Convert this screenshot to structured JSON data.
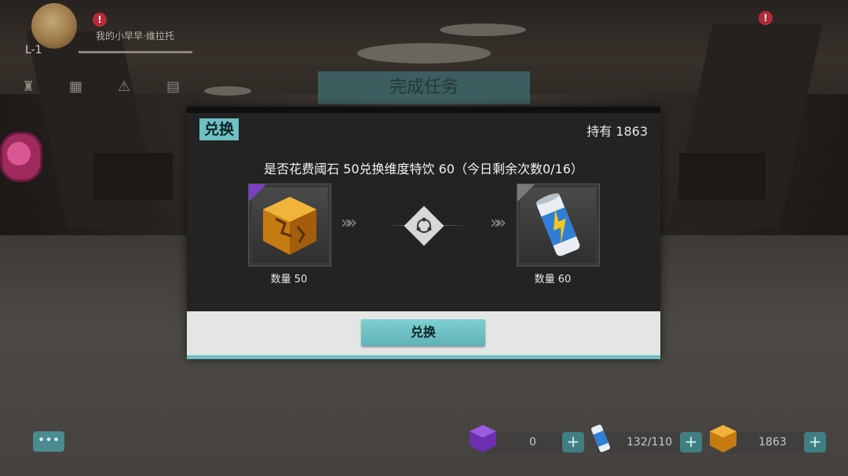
{
  "hud": {
    "level": "L-1",
    "player_name": "我的小早早·维拉托"
  },
  "background_title": "完成任务",
  "dialog": {
    "title": "兑换",
    "owned": "持有 1863",
    "question": "是否花费阈石 50兑换维度特饮 60（今日剩余次数0/16）",
    "cost_qty": "数量 50",
    "reward_qty": "数量 60",
    "confirm_label": "兑换",
    "arrows": "»",
    "colors": {
      "accent": "#6fc0c4",
      "panel": "#232323",
      "cost_corner": "#7b3fc4",
      "reward_corner": "#7a7a7a"
    },
    "cost_icon": "amber-cube-icon",
    "reward_icon": "energy-drink-can-icon"
  },
  "bottom_bar": {
    "chat_icon": "•••",
    "resources": [
      {
        "icon": "purple-cube-icon",
        "value": "0"
      },
      {
        "icon": "energy-drink-icon",
        "value": "132/110"
      },
      {
        "icon": "amber-cube-icon",
        "value": "1863"
      }
    ],
    "plus": "+"
  }
}
